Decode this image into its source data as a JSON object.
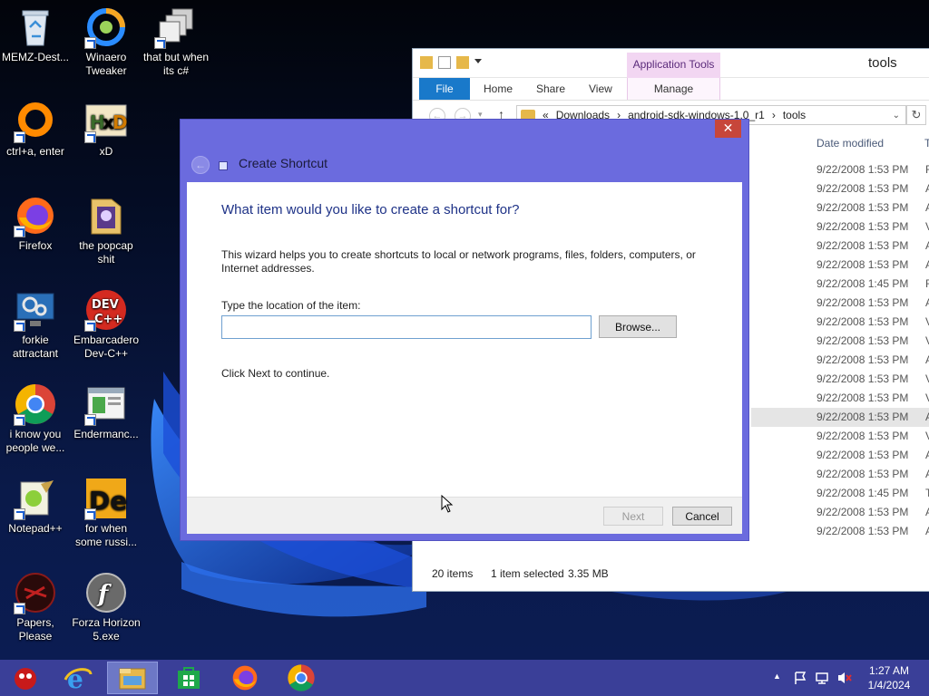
{
  "desktop": {
    "icons": [
      {
        "label": "MEMZ-Dest...",
        "icon": "recycle-bin-icon"
      },
      {
        "label": "Winaero Tweaker",
        "icon": "winaero-tweaker-icon"
      },
      {
        "label": "that but when its c#",
        "icon": "stacked-windows-icon"
      },
      {
        "label": "ctrl+a, enter",
        "icon": "orange-ring-icon"
      },
      {
        "label": "xD",
        "icon": "hxd-icon"
      },
      {
        "label": "Firefox",
        "icon": "firefox-icon"
      },
      {
        "label": "the popcap shit",
        "icon": "popcap-folder-icon"
      },
      {
        "label": "forkie attractant",
        "icon": "monitor-gears-icon"
      },
      {
        "label": "Embarcadero Dev-C++",
        "icon": "dev-cpp-icon"
      },
      {
        "label": "i know you people we...",
        "icon": "chrome-icon"
      },
      {
        "label": "Endermanc...",
        "icon": "endermanch-window-icon"
      },
      {
        "label": "Notepad++",
        "icon": "notepadpp-icon"
      },
      {
        "label": "for when some russi...",
        "icon": "de-icon"
      },
      {
        "label": "Papers, Please",
        "icon": "papers-please-icon"
      },
      {
        "label": "Forza Horizon 5.exe",
        "icon": "flash-player-icon"
      }
    ]
  },
  "explorer": {
    "window_title": "tools",
    "context_tab": "Application Tools",
    "ribbon_tabs": [
      "File",
      "Home",
      "Share",
      "View",
      "Manage"
    ],
    "breadcrumb": {
      "overflow": "«",
      "parts": [
        "Downloads",
        "android-sdk-windows-1.0_r1",
        "tools"
      ]
    },
    "column_header": "Date modified",
    "rows": [
      {
        "date": "9/22/2008 1:53 PM",
        "type": "F"
      },
      {
        "date": "9/22/2008 1:53 PM",
        "type": "A"
      },
      {
        "date": "9/22/2008 1:53 PM",
        "type": "A"
      },
      {
        "date": "9/22/2008 1:53 PM",
        "type": "V"
      },
      {
        "date": "9/22/2008 1:53 PM",
        "type": "A"
      },
      {
        "date": "9/22/2008 1:53 PM",
        "type": "A"
      },
      {
        "date": "9/22/2008 1:45 PM",
        "type": "F"
      },
      {
        "date": "9/22/2008 1:53 PM",
        "type": "A"
      },
      {
        "date": "9/22/2008 1:53 PM",
        "type": "V"
      },
      {
        "date": "9/22/2008 1:53 PM",
        "type": "V"
      },
      {
        "date": "9/22/2008 1:53 PM",
        "type": "A"
      },
      {
        "date": "9/22/2008 1:53 PM",
        "type": "V"
      },
      {
        "date": "9/22/2008 1:53 PM",
        "type": "V"
      },
      {
        "date": "9/22/2008 1:53 PM",
        "type": "A"
      },
      {
        "date": "9/22/2008 1:53 PM",
        "type": "V"
      },
      {
        "date": "9/22/2008 1:53 PM",
        "type": "A"
      },
      {
        "date": "9/22/2008 1:53 PM",
        "type": "A"
      },
      {
        "date": "9/22/2008 1:45 PM",
        "type": "T"
      },
      {
        "date": "9/22/2008 1:53 PM",
        "type": "A"
      },
      {
        "date": "9/22/2008 1:53 PM",
        "type": "A"
      }
    ],
    "selected_row": 13,
    "status": {
      "count": "20 items",
      "selected": "1 item selected",
      "size": "3.35 MB"
    }
  },
  "wizard": {
    "title": "Create Shortcut",
    "close": "✕",
    "heading": "What item would you like to create a shortcut for?",
    "description": "This wizard helps you to create shortcuts to local or network programs, files, folders, computers, or Internet addresses.",
    "location_label": "Type the location of the item:",
    "location_value": "",
    "browse_label": "Browse...",
    "hint": "Click Next to continue.",
    "next_label": "Next",
    "cancel_label": "Cancel"
  },
  "taskbar": {
    "apps": [
      "memz-icon",
      "internet-explorer-icon",
      "file-explorer-icon",
      "store-icon",
      "firefox-icon",
      "chrome-icon"
    ],
    "active_app": "file-explorer-icon",
    "tray": [
      "show-hidden-icons",
      "action-center-flag-icon",
      "network-icon",
      "volume-muted-icon"
    ],
    "time": "1:27 AM",
    "date": "1/4/2024"
  },
  "colors": {
    "wizard_frame": "#6b6bde",
    "taskbar": "#3a3f98",
    "heading": "#1e3287",
    "file_tab": "#1979ca",
    "app_tools_tab": "#f2d6f2"
  }
}
